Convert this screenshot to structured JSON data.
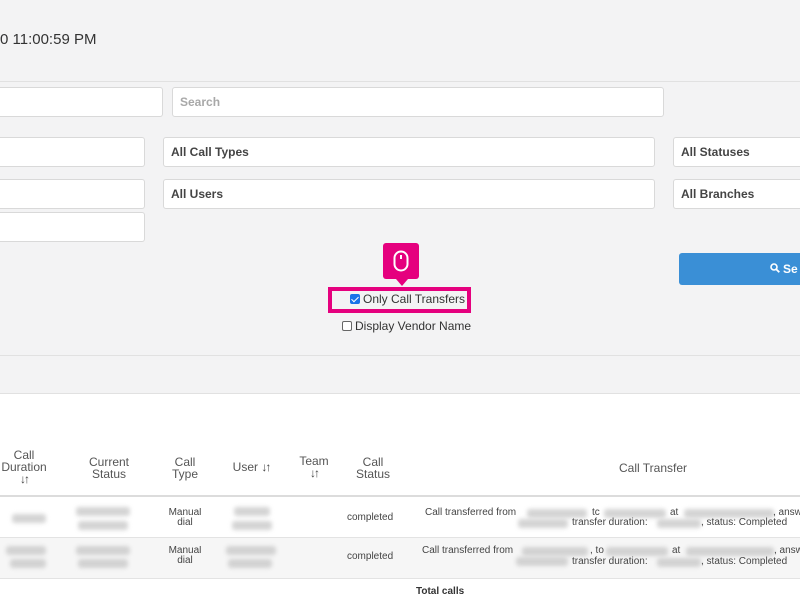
{
  "header": {
    "time_text": "0 11:00:59 PM"
  },
  "filters": {
    "search_placeholder": "Search",
    "call_types": "All Call Types",
    "statuses": "All Statuses",
    "users": "All Users",
    "branches": "All Branches"
  },
  "search_button": {
    "label": "Se",
    "icon": "search-icon"
  },
  "options": {
    "only_call_transfers": {
      "label": "Only Call Transfers",
      "checked": true
    },
    "display_vendor_name": {
      "label": "Display Vendor Name",
      "checked": false
    }
  },
  "cursor_badge": {
    "icon": "mouse-icon",
    "color": "#e5007e"
  },
  "table": {
    "headers": {
      "call_duration": "Call Duration",
      "current_status": "Current Status",
      "call_type": "Call Type",
      "user": "User",
      "team": "Team",
      "call_status": "Call Status",
      "call_transfer": "Call Transfer"
    },
    "rows": [
      {
        "call_type": "Manual dial",
        "call_status": "completed",
        "transfer_line1_a": "Call transferred from",
        "transfer_line1_b": "tc",
        "transfer_line1_c": "at",
        "transfer_line1_d": ", answ",
        "transfer_line2_a": "transfer duration:",
        "transfer_line2_b": ", status: Completed"
      },
      {
        "call_type": "Manual dial",
        "call_status": "completed",
        "transfer_line1_a": "Call transferred from",
        "transfer_line1_b": ", to",
        "transfer_line1_c": "at",
        "transfer_line1_d": ", answ",
        "transfer_line2_a": "transfer duration:",
        "transfer_line2_b": ", status: Completed"
      }
    ],
    "total_label": "Total calls"
  }
}
